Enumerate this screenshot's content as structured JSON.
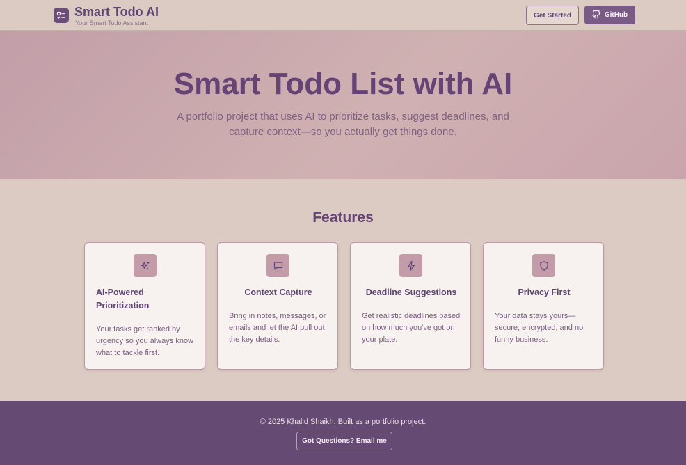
{
  "header": {
    "brand_title": "Smart Todo AI",
    "brand_subtitle": "Your Smart Todo Assistant",
    "get_started_label": "Get Started",
    "github_label": "GitHub"
  },
  "hero": {
    "title": "Smart Todo List with AI",
    "description": "A portfolio project that uses AI to prioritize tasks, suggest deadlines, and capture context—so you actually get things done."
  },
  "features": {
    "title": "Features",
    "items": [
      {
        "icon": "sparkles-icon",
        "title": "AI-Powered Prioritization",
        "body": "Your tasks get ranked by urgency so you always know what to tackle first."
      },
      {
        "icon": "message-icon",
        "title": "Context Capture",
        "body": "Bring in notes, messages, or emails and let the AI pull out the key details."
      },
      {
        "icon": "lightning-icon",
        "title": "Deadline Suggestions",
        "body": "Get realistic deadlines based on how much you've got on your plate."
      },
      {
        "icon": "shield-icon",
        "title": "Privacy First",
        "body": "Your data stays yours—secure, encrypted, and no funny business."
      }
    ]
  },
  "footer": {
    "copyright": "© 2025 Khalid Shaikh. Built as a portfolio project.",
    "contact_label": "Got Questions? Email me"
  },
  "colors": {
    "accent": "#654a73",
    "background": "#dccbc2",
    "card_bg": "#f7f2ef",
    "icon_bg": "#c49ba9"
  }
}
